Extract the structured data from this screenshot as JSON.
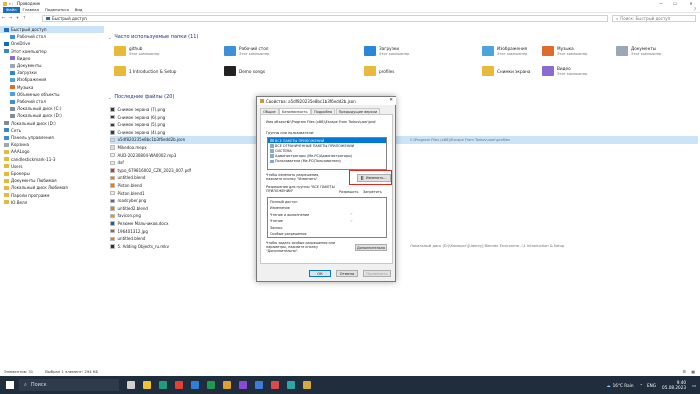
{
  "window": {
    "title": "Проводник",
    "controls": [
      "—",
      "☐",
      "✕"
    ]
  },
  "ribbon": {
    "tabs": [
      "Файл",
      "Главная",
      "Поделиться",
      "Вид"
    ],
    "help": "?"
  },
  "address": {
    "path": "Быстрый доступ",
    "search_placeholder": "Поиск: Быстрый доступ"
  },
  "sidebar": {
    "items": [
      {
        "label": "Быстрый доступ",
        "icon": "star-icon",
        "color": "#1a6fc4",
        "indent": 0,
        "active": true
      },
      {
        "label": "Рабочий стол",
        "icon": "folder-icon",
        "color": "#3c8fd8",
        "indent": 1
      },
      {
        "label": "OneDrive",
        "icon": "cloud-icon",
        "color": "#0f6cbd",
        "indent": 0
      },
      {
        "label": "Этот компьютер",
        "icon": "computer-icon",
        "color": "#3b86c9",
        "indent": 0
      },
      {
        "label": "Видео",
        "icon": "video-icon",
        "color": "#8a6bd1",
        "indent": 1
      },
      {
        "label": "Документы",
        "icon": "document-icon",
        "color": "#9aa7b5",
        "indent": 1
      },
      {
        "label": "Загрузки",
        "icon": "download-icon",
        "color": "#2a86d8",
        "indent": 1
      },
      {
        "label": "Изображения",
        "icon": "image-icon",
        "color": "#4ca3dd",
        "indent": 1
      },
      {
        "label": "Музыка",
        "icon": "music-icon",
        "color": "#e06c2b",
        "indent": 1
      },
      {
        "label": "Объемные объекты",
        "icon": "cube-icon",
        "color": "#46a3e0",
        "indent": 1
      },
      {
        "label": "Рабочий стол",
        "icon": "folder-icon",
        "color": "#3c8fd8",
        "indent": 1
      },
      {
        "label": "Локальный диск (C:)",
        "icon": "drive-icon",
        "color": "#7f8c99",
        "indent": 1
      },
      {
        "label": "Локальный диск (D:)",
        "icon": "drive-icon",
        "color": "#7f8c99",
        "indent": 1
      },
      {
        "label": "Локальный диск (D:)",
        "icon": "drive-icon",
        "color": "#7f8c99",
        "indent": 0
      },
      {
        "label": "Сеть",
        "icon": "network-icon",
        "color": "#3b86c9",
        "indent": 0
      },
      {
        "label": "Панель управления",
        "icon": "control-panel-icon",
        "color": "#3f8bd1",
        "indent": 0
      },
      {
        "label": "Корзина",
        "icon": "recycle-bin-icon",
        "color": "#9aa7b5",
        "indent": 0
      },
      {
        "label": "AAALogo",
        "icon": "folder-icon",
        "color": "#e8b93a",
        "indent": 0
      },
      {
        "label": "candlestickmark-11-3",
        "icon": "folder-icon",
        "color": "#e8b93a",
        "indent": 0
      },
      {
        "label": "Users",
        "icon": "folder-icon",
        "color": "#e8b93a",
        "indent": 0
      },
      {
        "label": "Брокеры",
        "icon": "folder-icon",
        "color": "#e8b93a",
        "indent": 0
      },
      {
        "label": "Документы Любимая",
        "icon": "folder-icon",
        "color": "#e8b93a",
        "indent": 0
      },
      {
        "label": "Локальный диск Любимая",
        "icon": "folder-icon",
        "color": "#e8b93a",
        "indent": 0
      },
      {
        "label": "Пароли программ",
        "icon": "folder-icon",
        "color": "#e8b93a",
        "indent": 0
      },
      {
        "label": "Ю.Велл",
        "icon": "folder-icon",
        "color": "#e8b93a",
        "indent": 0
      }
    ]
  },
  "frequent": {
    "header": "Часто используемые папки (11)",
    "items": [
      {
        "name": "github",
        "sub": "Этот компьютер",
        "icon": "folder-icon",
        "color": "#e8b93a"
      },
      {
        "name": "Рабочий стол",
        "sub": "Этот компьютер",
        "icon": "folder-icon",
        "color": "#3c8fd8"
      },
      {
        "name": "Загрузки",
        "sub": "Этот компьютер",
        "icon": "download-icon",
        "color": "#2a86d8"
      },
      {
        "name": "Изображения",
        "sub": "Этот компьютер",
        "icon": "image-icon",
        "color": "#4ca3dd"
      },
      {
        "name": "Музыка",
        "sub": "Этот компьютер",
        "icon": "music-icon",
        "color": "#e06c2b"
      },
      {
        "name": "Документы",
        "sub": "Этот компьютер",
        "icon": "document-icon",
        "color": "#9aa7b5"
      },
      {
        "name": "1 Introduction & Setup",
        "sub": "",
        "icon": "folder-icon",
        "color": "#e8b93a"
      },
      {
        "name": "Demo songs",
        "sub": "",
        "icon": "folder-icon",
        "color": "#222222"
      },
      {
        "name": "profiles",
        "sub": "",
        "icon": "folder-icon",
        "color": "#e8b93a"
      },
      {
        "name": "Снимки экрана",
        "sub": "",
        "icon": "folder-icon",
        "color": "#e8b93a"
      },
      {
        "name": "Видео",
        "sub": "Этот компьютер",
        "icon": "video-icon",
        "color": "#8a6bd1"
      }
    ]
  },
  "recent": {
    "header": "Последние файлы (20)",
    "items": [
      {
        "name": "Снимок экрана (7).png",
        "path": "",
        "icon": "image-file-icon",
        "color": "#3b3b3b"
      },
      {
        "name": "Снимок экрана (6).png",
        "path": "",
        "icon": "image-file-icon",
        "color": "#3b3b3b"
      },
      {
        "name": "Снимок экрана (5).png",
        "path": "",
        "icon": "image-file-icon",
        "color": "#3b3b3b"
      },
      {
        "name": "Снимок экрана (4).png",
        "path": "",
        "icon": "image-file-icon",
        "color": "#3b3b3b"
      },
      {
        "name": "a5df820235e8bc1b3f6edd2b.json",
        "path": "C:\\Program Files (x86)\\Escape From Tarkov\\user\\profiles",
        "icon": "json-file-icon",
        "color": "#d9d9d9",
        "selected": true
      },
      {
        "name": "Mikedoa.mepx",
        "path": "",
        "icon": "file-icon",
        "color": "#dddddd"
      },
      {
        "name": "AUD-20230804-WA0002.mp3",
        "path": "",
        "icon": "audio-file-icon",
        "color": "#f0f0f0"
      },
      {
        "name": "dxf",
        "path": "",
        "icon": "file-icon",
        "color": "#ececec"
      },
      {
        "name": "typo_679816002_CZK_2023_007.pdf",
        "path": "",
        "icon": "pdf-file-icon",
        "color": "#d8342a"
      },
      {
        "name": "untitled.blend",
        "path": "",
        "icon": "blend-file-icon",
        "color": "#e87d0d"
      },
      {
        "name": "Piston.blend",
        "path": "",
        "icon": "blend-file-icon",
        "color": "#e87d0d"
      },
      {
        "name": "Piston.blend1",
        "path": "",
        "icon": "file-icon",
        "color": "#ececec"
      },
      {
        "name": "roadcyber.png",
        "path": "",
        "icon": "image-file-icon",
        "color": "#6a5a9a"
      },
      {
        "name": "untitled2.blend",
        "path": "",
        "icon": "blend-file-icon",
        "color": "#e87d0d"
      },
      {
        "name": "favicon.png",
        "path": "",
        "icon": "image-file-icon",
        "color": "#ff8a00"
      },
      {
        "name": "Резюме Мальчиков.docx",
        "path": "",
        "icon": "word-file-icon",
        "color": "#2b579a"
      },
      {
        "name": "196401312.jpg",
        "path": "",
        "icon": "image-file-icon",
        "color": "#8b6b4a"
      },
      {
        "name": "untitled.blend",
        "path": "",
        "icon": "blend-file-icon",
        "color": "#e87d0d"
      },
      {
        "name": "5. Adding Objects_ru.mkv",
        "path": "Локальный диск (D:)\\Компрог\\[Udemy] Blender Environme...\\1 Introduction & Setup",
        "icon": "video-file-icon",
        "color": "#333333"
      }
    ]
  },
  "statusbar": {
    "count": "Элементов: 31",
    "selected": "Выбран 1 элемент: 294 КБ"
  },
  "taskbar": {
    "search_placeholder": "Поиск",
    "weather": "16°C  Rain",
    "lang": "ENG",
    "time": "9:40",
    "date": "05.08.2023",
    "apps": [
      {
        "name": "task-view-icon",
        "color": "#d0d0d0"
      },
      {
        "name": "explorer-icon",
        "color": "#f1c232"
      },
      {
        "name": "edge-icon",
        "color": "#1f9c7a"
      },
      {
        "name": "chrome-icon",
        "color": "#e34133"
      },
      {
        "name": "app-icon",
        "color": "#2f7fd6"
      },
      {
        "name": "app-icon",
        "color": "#1d9a4e"
      },
      {
        "name": "app-icon",
        "color": "#e0a030"
      },
      {
        "name": "app-icon",
        "color": "#8a4ad6"
      },
      {
        "name": "app-icon",
        "color": "#3e7cd6"
      },
      {
        "name": "app-icon",
        "color": "#d94a4a"
      },
      {
        "name": "app-icon",
        "color": "#2aa8a8"
      },
      {
        "name": "app-icon",
        "color": "#d6a93e"
      }
    ]
  },
  "dialog": {
    "title": "Свойства: a5df820235e8bc1b3f6edd2b.json",
    "close": "✕",
    "tabs": [
      "Общие",
      "Безопасность",
      "Подробно",
      "Предыдущие версии"
    ],
    "object_label": "Имя объекта:",
    "object_value": "C:\\Program Files (x86)\\Escape From Tarkov\\user\\prof",
    "groups_label": "Группы или пользователи:",
    "users": [
      "ВСЕ ПАКЕТЫ ПРИЛОЖЕНИЙ",
      "ВСЕ ОГРАНИЧЕННЫЕ ПАКЕТЫ ПРИЛОЖЕНИЙ",
      "СИСТЕМА",
      "Администраторы (Ме-PC\\Администраторы)",
      "Пользователи (Ме-PC\\Пользователи)"
    ],
    "change_hint": "Чтобы изменить разрешения,\nнажмите кнопку \"Изменить\".",
    "change_button": "Изменить...",
    "perm_for": "Разрешения для группы \"ВСЕ ПАКЕТЫ\nПРИЛОЖЕНИЙ\"",
    "allow": "Разрешить",
    "deny": "Запретить",
    "permissions": [
      {
        "name": "Полный доступ",
        "allow": ""
      },
      {
        "name": "Изменение",
        "allow": ""
      },
      {
        "name": "Чтение и выполнение",
        "allow": "✓"
      },
      {
        "name": "Чтение",
        "allow": "✓"
      },
      {
        "name": "Запись",
        "allow": ""
      },
      {
        "name": "Особые разрешения",
        "allow": ""
      }
    ],
    "adv_hint": "Чтобы задать особые разрешения или\nпараметры, нажмите кнопку\n\"Дополнительно\".",
    "adv_button": "Дополнительно",
    "ok": "ОК",
    "cancel": "Отмена",
    "apply": "Применить"
  }
}
